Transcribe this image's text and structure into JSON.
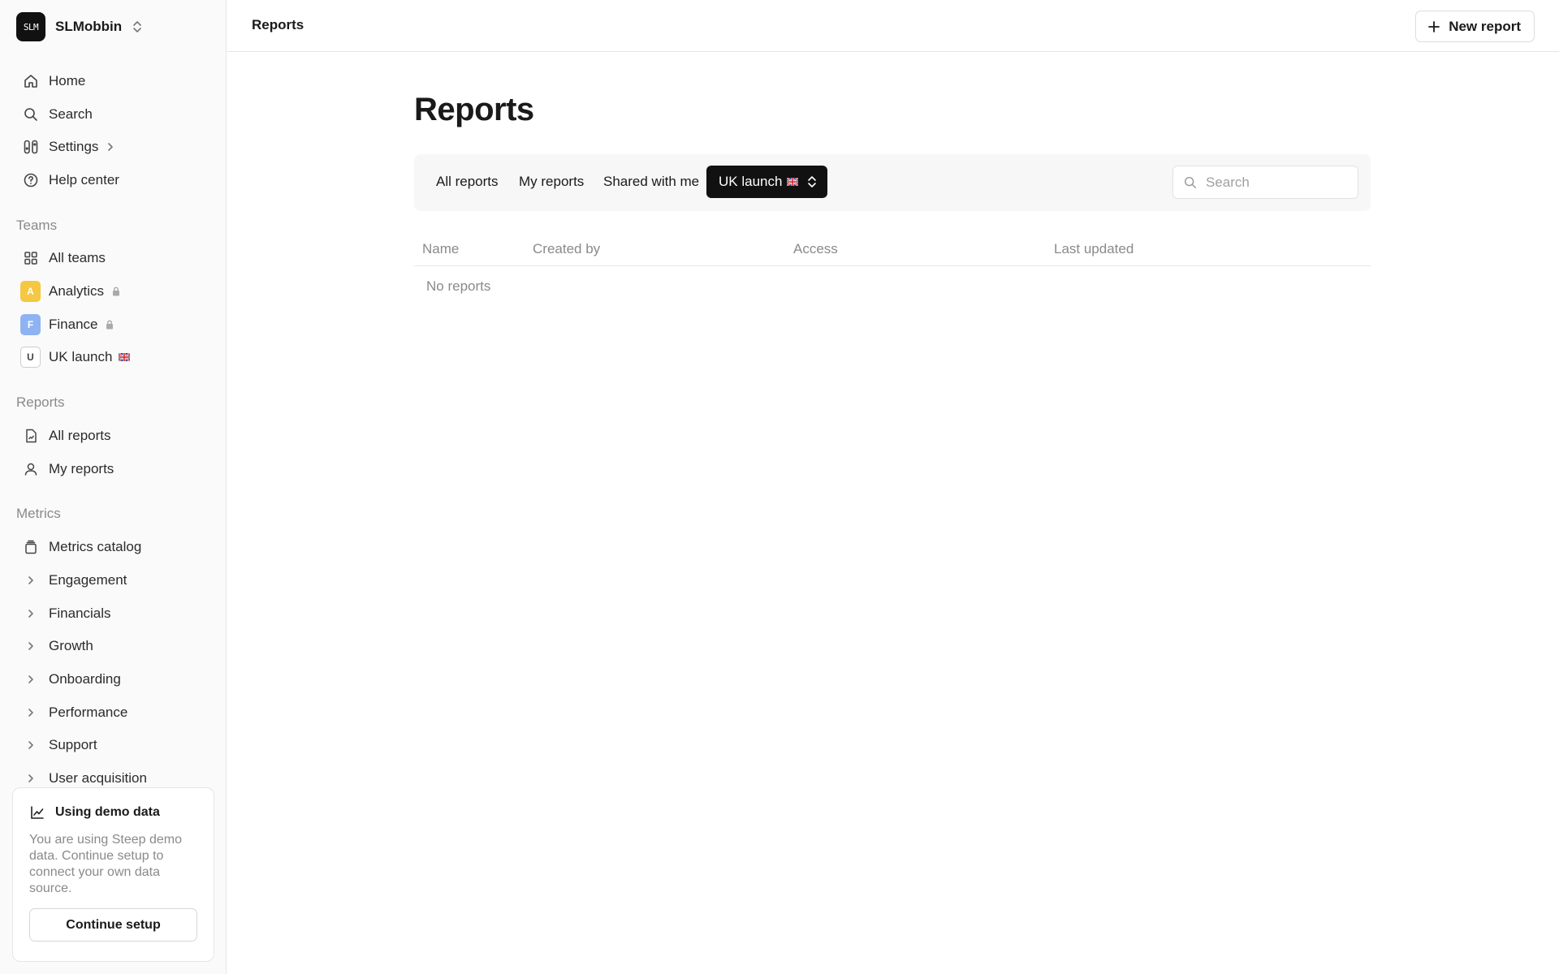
{
  "workspace": {
    "logo_text": "SLM",
    "name": "SLMobbin"
  },
  "nav": [
    {
      "label": "Home",
      "icon": "home-icon"
    },
    {
      "label": "Search",
      "icon": "search-icon"
    },
    {
      "label": "Settings",
      "icon": "settings-icon"
    },
    {
      "label": "Help center",
      "icon": "help-icon"
    }
  ],
  "teams": {
    "section_label": "Teams",
    "all_label": "All teams",
    "items": [
      {
        "badge": "A",
        "label": "Analytics"
      },
      {
        "badge": "F",
        "label": "Finance"
      },
      {
        "badge": "U",
        "label": "UK launch"
      }
    ]
  },
  "reports_nav": {
    "section_label": "Reports",
    "items": [
      {
        "label": "All reports"
      },
      {
        "label": "My reports"
      }
    ]
  },
  "metrics": {
    "section_label": "Metrics",
    "catalog_label": "Metrics catalog",
    "groups": [
      "Engagement",
      "Financials",
      "Growth",
      "Onboarding",
      "Performance",
      "Support",
      "User acquisition"
    ]
  },
  "demo": {
    "title": "Using demo data",
    "text": "You are using Steep demo data. Continue setup to connect your own data source.",
    "button": "Continue setup"
  },
  "topbar": {
    "title": "Reports",
    "new_button": "New report"
  },
  "main": {
    "title": "Reports",
    "tabs": [
      "All reports",
      "My reports",
      "Shared with me"
    ],
    "active_filter": "UK launch",
    "search_placeholder": "Search",
    "columns": [
      "Name",
      "Created by",
      "Access",
      "Last updated"
    ],
    "empty_text": "No reports"
  },
  "colors": {
    "accent_dark": "#111111",
    "team_analytics": "#f4c842",
    "team_finance": "#8fb3f2"
  }
}
